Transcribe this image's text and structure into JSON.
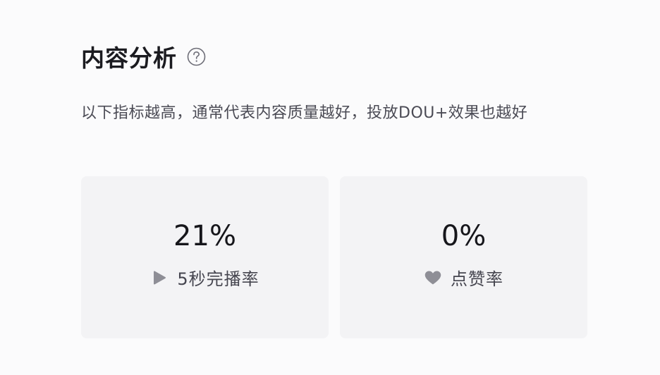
{
  "section": {
    "title": "内容分析",
    "help_icon": "question-circle-icon",
    "description": "以下指标越高，通常代表内容质量越好，投放DOU+效果也越好"
  },
  "metrics": [
    {
      "value": "21%",
      "label": "5秒完播率",
      "icon": "play-triangle-icon"
    },
    {
      "value": "0%",
      "label": "点赞率",
      "icon": "heart-icon"
    }
  ],
  "colors": {
    "page_background": "#fbfbfc",
    "card_background": "#f3f3f5",
    "icon_gray": "#8e8e96"
  }
}
